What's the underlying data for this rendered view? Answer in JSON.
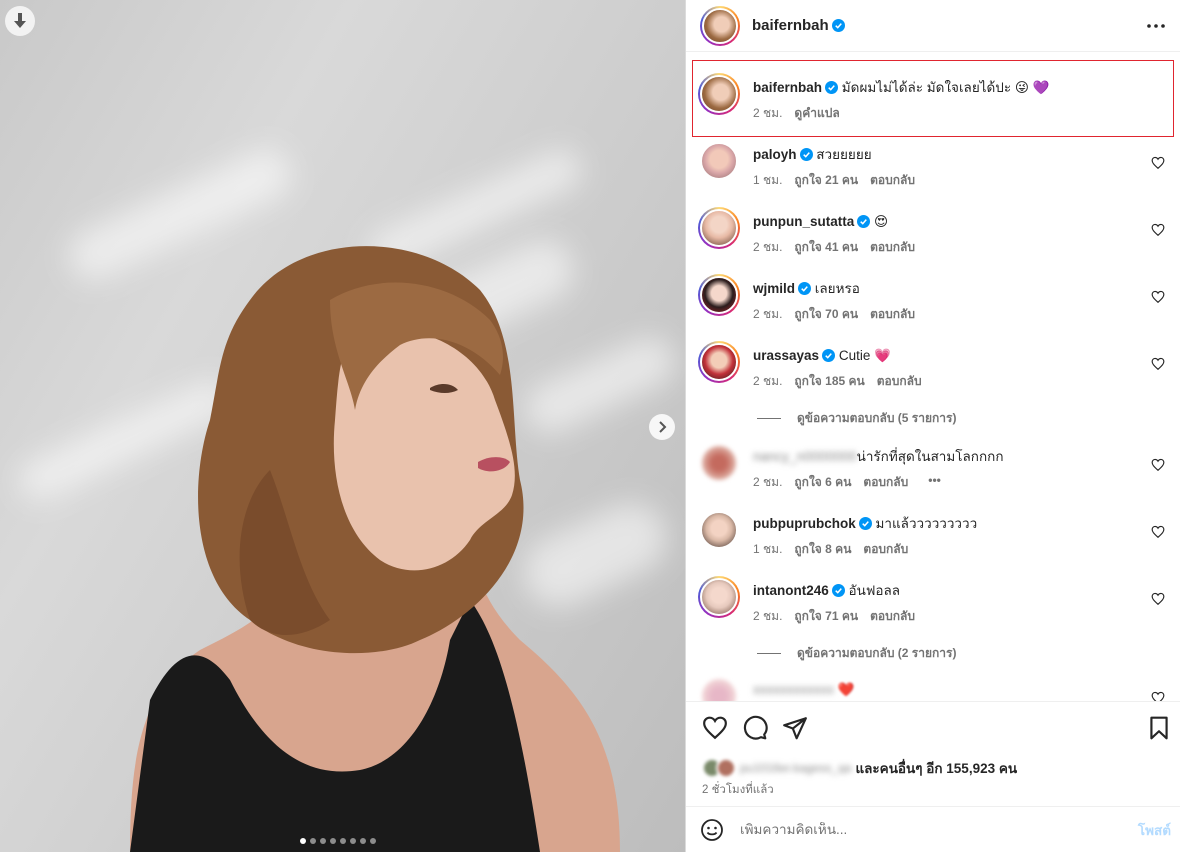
{
  "post": {
    "author": "baifernbah",
    "slide_count": 8,
    "active_slide": 1
  },
  "caption": {
    "username": "baifernbah",
    "text": "มัดผมไม่ได้ล่ะ มัดใจเลยได้ปะ 😜 💜",
    "time": "2 ชม.",
    "translate": "ดูคำแปล"
  },
  "comments": [
    {
      "username": "paloyh",
      "verified": true,
      "text": "สวยยยยย",
      "time": "1 ชม.",
      "likes": "ถูกใจ 21 คน",
      "reply": "ตอบกลับ"
    },
    {
      "username": "punpun_sutatta",
      "verified": true,
      "text": "😍",
      "time": "2 ชม.",
      "likes": "ถูกใจ 41 คน",
      "reply": "ตอบกลับ"
    },
    {
      "username": "wjmild",
      "verified": true,
      "text": "เลยหรอ",
      "time": "2 ชม.",
      "likes": "ถูกใจ 70 คน",
      "reply": "ตอบกลับ"
    },
    {
      "username": "urassayas",
      "verified": true,
      "text": "Cutie 💗",
      "time": "2 ชม.",
      "likes": "ถูกใจ 185 คน",
      "reply": "ตอบกลับ",
      "view_replies": "ดูข้อความตอบกลับ (5 รายการ)"
    },
    {
      "username": "nancy_n0000000",
      "verified": false,
      "blurred": true,
      "text": "น่ารักที่สุดในสามโลกกกก",
      "time": "2 ชม.",
      "likes": "ถูกใจ 6 คน",
      "reply": "ตอบกลับ",
      "more": "•••"
    },
    {
      "username": "pubpuprubchok",
      "verified": true,
      "text": "มาแล้ววววววววว",
      "time": "1 ชม.",
      "likes": "ถูกใจ 8 คน",
      "reply": "ตอบกลับ"
    },
    {
      "username": "intanont246",
      "verified": true,
      "text": "อันฟอลล",
      "time": "2 ชม.",
      "likes": "ถูกใจ 71 คน",
      "reply": "ตอบกลับ",
      "view_replies": "ดูข้อความตอบกลับ (2 รายการ)"
    },
    {
      "username": "xxxxxxxxxxxx",
      "verified": false,
      "blurred": true,
      "text": "❤️"
    }
  ],
  "likes_summary": {
    "blurred_names": "pu1016er.kagess_qa",
    "text": "และคนอื่นๆ อีก 155,923 คน"
  },
  "time_ago": "2 ชั่วโมงที่แล้ว",
  "composer": {
    "placeholder": "เพิ่มความคิดเห็น...",
    "post_label": "โพสต์"
  },
  "colors": {
    "verified": "#0095f6",
    "highlight": "#e0252f",
    "post_disabled": "#b3dbff"
  }
}
